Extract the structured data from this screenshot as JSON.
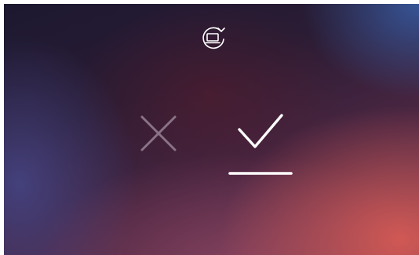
{
  "screen": {
    "top_icon": "screen-rotate-icon",
    "cancel_icon": "close-x-icon",
    "confirm_icon": "checkmark-icon",
    "confirm_selected": true,
    "colors": {
      "icon_active": "#ffffff",
      "icon_inactive": "#8a7386",
      "bg_dark": "#1c1830",
      "bg_accent": "#d65a54"
    }
  }
}
